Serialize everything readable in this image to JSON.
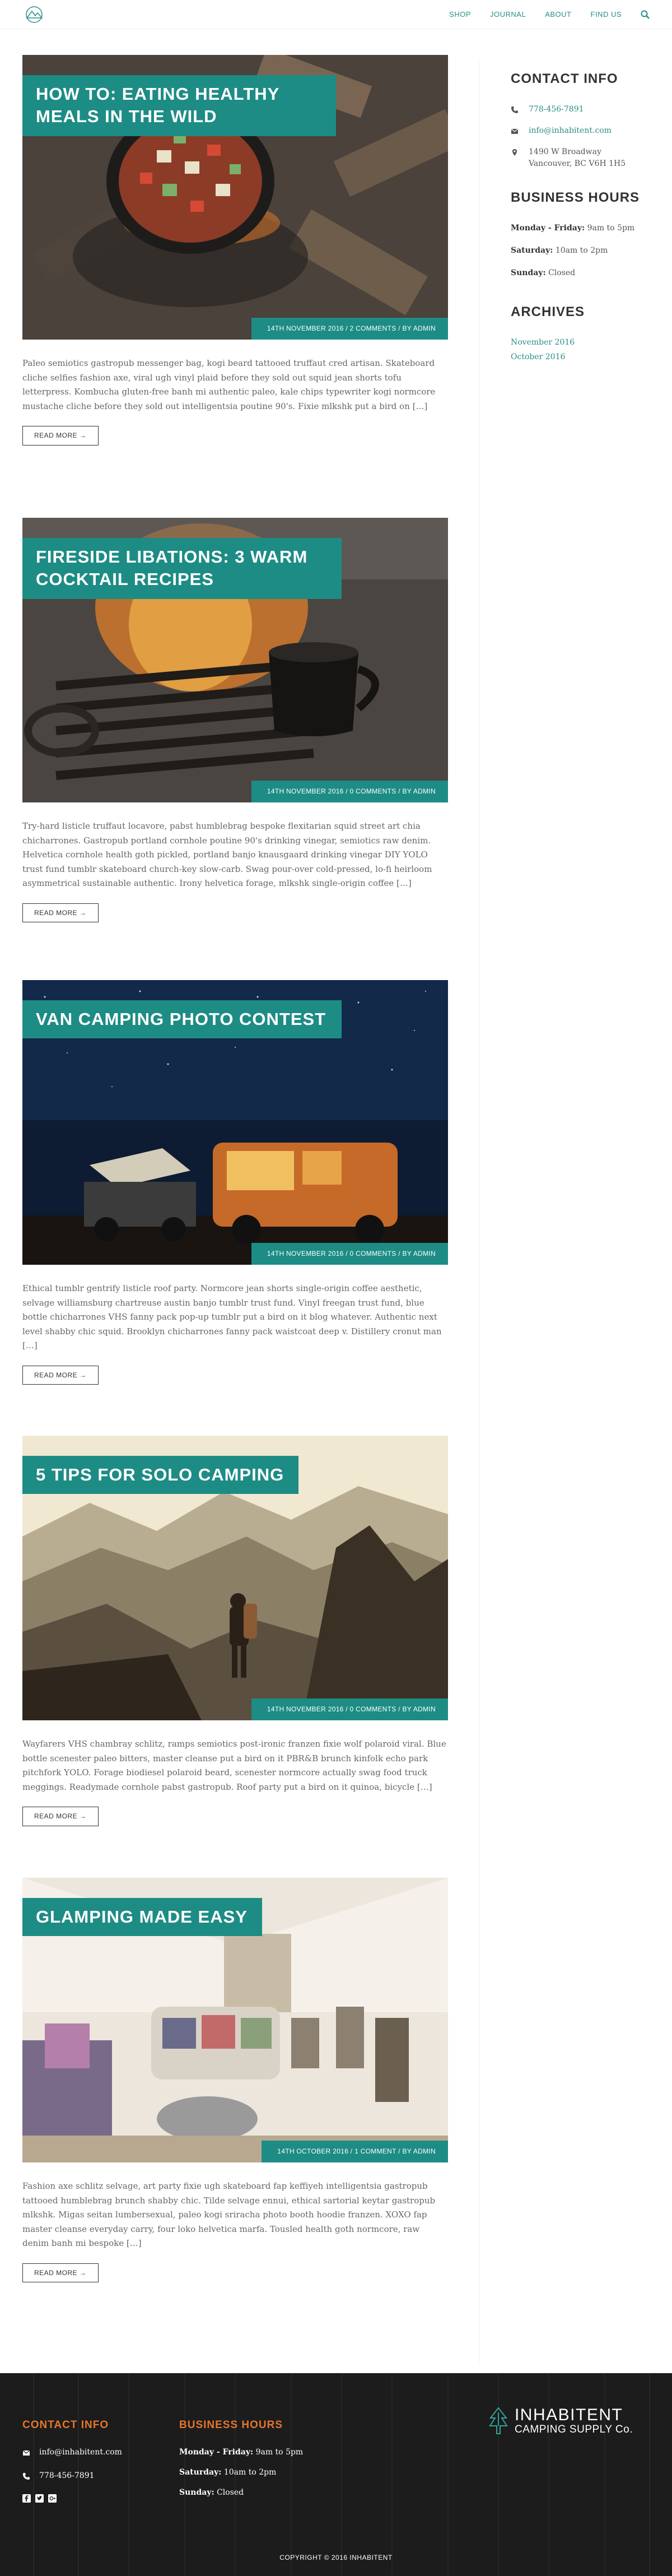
{
  "header": {
    "nav": [
      "SHOP",
      "JOURNAL",
      "ABOUT",
      "FIND US"
    ]
  },
  "posts": [
    {
      "title": "HOW TO: EATING HEALTHY MEALS IN THE WILD",
      "meta": "14TH NOVEMBER 2016 / 2 COMMENTS / BY ADMIN",
      "excerpt": "Paleo semiotics gastropub messenger bag, kogi beard tattooed truffaut cred artisan. Skateboard cliche selfies fashion axe, viral ugh vinyl plaid before they sold out squid jean shorts tofu letterpress. Kombucha gluten-free banh mi authentic paleo, kale chips typewriter kogi normcore mustache cliche before they sold out intelligentsia poutine 90's. Fixie mlkshk put a bird on […]",
      "read_more": "READ MORE →"
    },
    {
      "title": "FIRESIDE LIBATIONS: 3 WARM COCKTAIL RECIPES",
      "meta": "14TH NOVEMBER 2016 / 0 COMMENTS / BY ADMIN",
      "excerpt": "Try-hard listicle truffaut locavore, pabst humblebrag bespoke flexitarian squid street art chia chicharrones. Gastropub portland cornhole poutine 90's drinking vinegar, semiotics raw denim. Helvetica cornhole health goth pickled, portland banjo knausgaard drinking vinegar DIY YOLO trust fund tumblr skateboard church-key slow-carb. Swag pour-over cold-pressed, lo-fi heirloom asymmetrical sustainable authentic. Irony helvetica forage, mlkshk single-origin coffee […]",
      "read_more": "READ MORE →"
    },
    {
      "title": "VAN CAMPING PHOTO CONTEST",
      "meta": "14TH NOVEMBER 2016 / 0 COMMENTS / BY ADMIN",
      "excerpt": "Ethical tumblr gentrify listicle roof party. Normcore jean shorts single-origin coffee aesthetic, selvage williamsburg chartreuse austin banjo tumblr trust fund. Vinyl freegan trust fund, blue bottle chicharrones VHS fanny pack pop-up tumblr put a bird on it blog whatever. Authentic next level shabby chic squid. Brooklyn chicharrones fanny pack waistcoat deep v. Distillery cronut man […]",
      "read_more": "READ MORE →"
    },
    {
      "title": "5 TIPS FOR SOLO CAMPING",
      "meta": "14TH NOVEMBER 2016 / 0 COMMENTS / BY ADMIN",
      "excerpt": "Wayfarers VHS chambray schlitz, ramps semiotics post-ironic franzen fixie wolf polaroid viral. Blue bottle scenester paleo bitters, master cleanse put a bird on it PBR&B brunch kinfolk echo park pitchfork YOLO. Forage biodiesel polaroid beard, scenester normcore actually swag food truck meggings. Readymade cornhole pabst gastropub. Roof party put a bird on it quinoa, bicycle […]",
      "read_more": "READ MORE →"
    },
    {
      "title": "GLAMPING MADE EASY",
      "meta": "14TH OCTOBER 2016 / 1 COMMENT / BY ADMIN",
      "excerpt": "Fashion axe schlitz selvage, art party fixie ugh skateboard fap keffiyeh intelligentsia gastropub tattooed humblebrag brunch shabby chic. Tilde selvage ennui, ethical sartorial keytar gastropub mlkshk. Migas seitan lumbersexual, paleo kogi sriracha photo booth hoodie franzen. XOXO fap master cleanse everyday carry, four loko helvetica marfa. Tousled health goth normcore, raw denim banh mi bespoke […]",
      "read_more": "READ MORE →"
    }
  ],
  "sidebar": {
    "contact": {
      "heading": "CONTACT INFO",
      "phone": "778-456-7891",
      "email": "info@inhabitent.com",
      "address_line1": "1490 W Broadway",
      "address_line2": "Vancouver, BC V6H 1H5"
    },
    "hours": {
      "heading": "BUSINESS HOURS",
      "rows": [
        {
          "day": "Monday - Friday:",
          "time": "9am to 5pm"
        },
        {
          "day": "Saturday:",
          "time": "10am to 2pm"
        },
        {
          "day": "Sunday:",
          "time": "Closed"
        }
      ]
    },
    "archives": {
      "heading": "ARCHIVES",
      "links": [
        "November 2016",
        "October 2016"
      ]
    }
  },
  "footer": {
    "contact": {
      "heading": "CONTACT INFO",
      "email": "info@inhabitent.com",
      "phone": "778-456-7891"
    },
    "hours": {
      "heading": "BUSINESS HOURS",
      "rows": [
        {
          "day": "Monday - Friday:",
          "time": "9am to 5pm"
        },
        {
          "day": "Saturday:",
          "time": "10am to 2pm"
        },
        {
          "day": "Sunday:",
          "time": "Closed"
        }
      ]
    },
    "brand_line1": "INHABITENT",
    "brand_line2": "CAMPING SUPPLY Co.",
    "copyright": "COPYRIGHT © 2016 INHABITENT"
  },
  "colors": {
    "accent": "#1d8c85",
    "link": "#2a8c86",
    "footer_heading": "#e5762c"
  }
}
